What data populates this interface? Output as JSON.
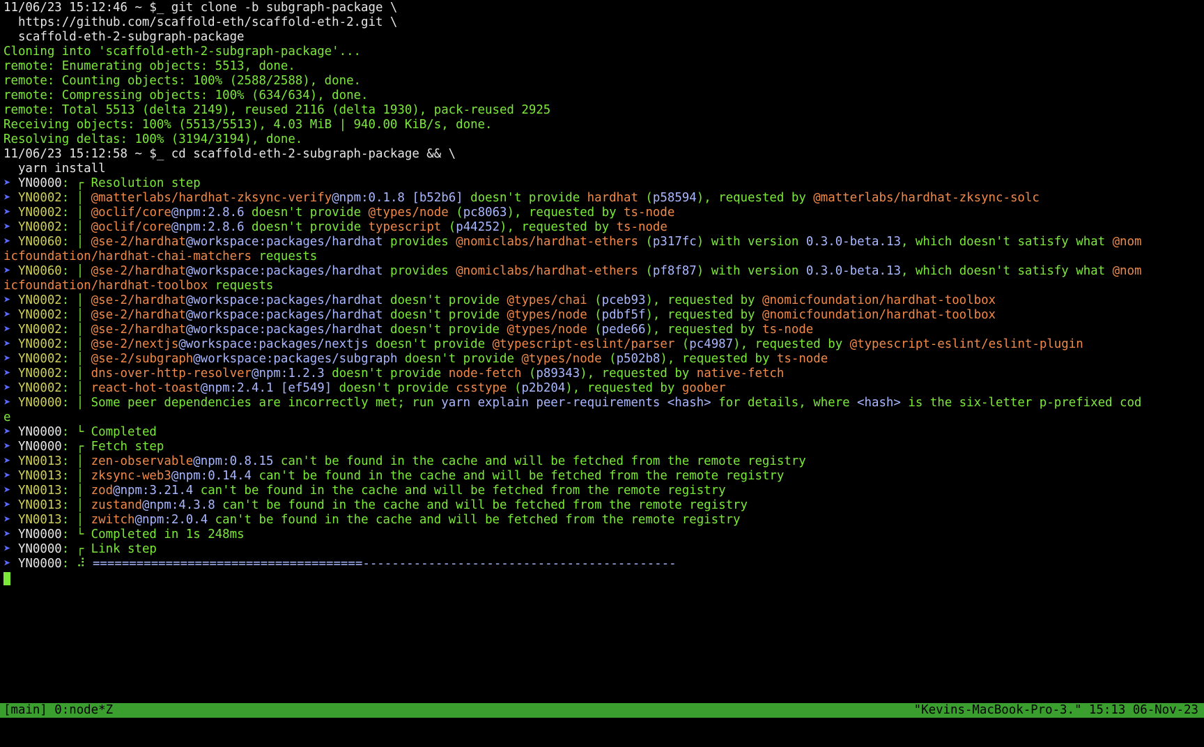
{
  "colors": {
    "green": "#7ce93a",
    "white": "#e6e6e6",
    "arrow": "#5b6bff",
    "code": "#cfd05a",
    "orange": "#f0894a",
    "blue": "#a9b7ff",
    "statusbar_bg": "#3a9f2e",
    "statusbar_fg": "#000000",
    "cursor": "#7ce93a"
  },
  "lines": [
    [
      {
        "t": "11/06/23 15:12:46 ~ $_ git clone -b subgraph-package \\",
        "c": "white"
      }
    ],
    [
      {
        "t": "  https://github.com/scaffold-eth/scaffold-eth-2.git \\",
        "c": "white"
      }
    ],
    [
      {
        "t": "  scaffold-eth-2-subgraph-package",
        "c": "white"
      }
    ],
    [
      {
        "t": "Cloning into 'scaffold-eth-2-subgraph-package'...",
        "c": "green"
      }
    ],
    [
      {
        "t": "remote: Enumerating objects: 5513, done.",
        "c": "green"
      }
    ],
    [
      {
        "t": "remote: Counting objects: 100% (2588/2588), done.",
        "c": "green"
      }
    ],
    [
      {
        "t": "remote: Compressing objects: 100% (634/634), done.",
        "c": "green"
      }
    ],
    [
      {
        "t": "remote: Total 5513 (delta 2149), reused 2116 (delta 1930), pack-reused 2925",
        "c": "green"
      }
    ],
    [
      {
        "t": "Receiving objects: 100% (5513/5513), 4.03 MiB | 940.00 KiB/s, done.",
        "c": "green"
      }
    ],
    [
      {
        "t": "Resolving deltas: 100% (3194/3194), done.",
        "c": "green"
      }
    ],
    [
      {
        "t": "11/06/23 15:12:58 ~ $_ cd scaffold-eth-2-subgraph-package && \\",
        "c": "white"
      }
    ],
    [
      {
        "t": "  yarn install",
        "c": "white"
      }
    ],
    [
      {
        "t": "➤ ",
        "c": "arrow"
      },
      {
        "t": "YN0000",
        "c": "white"
      },
      {
        "t": ": ",
        "c": "green"
      },
      {
        "t": "┌ Resolution step",
        "c": "green"
      }
    ],
    [
      {
        "t": "➤ ",
        "c": "arrow"
      },
      {
        "t": "YN0002",
        "c": "code"
      },
      {
        "t": ": │ ",
        "c": "green"
      },
      {
        "t": "@matterlabs/",
        "c": "orange"
      },
      {
        "t": "hardhat-zksync-verify",
        "c": "orange"
      },
      {
        "t": "@npm:0.1.8 [b52b6]",
        "c": "blue"
      },
      {
        "t": " doesn't provide ",
        "c": "green"
      },
      {
        "t": "hardhat",
        "c": "orange"
      },
      {
        "t": " (",
        "c": "green"
      },
      {
        "t": "p58594",
        "c": "blue"
      },
      {
        "t": "), requested by ",
        "c": "green"
      },
      {
        "t": "@matterlabs/hardhat-zksync-solc",
        "c": "orange"
      }
    ],
    [
      {
        "t": "➤ ",
        "c": "arrow"
      },
      {
        "t": "YN0002",
        "c": "code"
      },
      {
        "t": ": │ ",
        "c": "green"
      },
      {
        "t": "@oclif/",
        "c": "orange"
      },
      {
        "t": "core",
        "c": "orange"
      },
      {
        "t": "@npm:2.8.6",
        "c": "blue"
      },
      {
        "t": " doesn't provide ",
        "c": "green"
      },
      {
        "t": "@types/node",
        "c": "orange"
      },
      {
        "t": " (",
        "c": "green"
      },
      {
        "t": "pc8063",
        "c": "blue"
      },
      {
        "t": "), requested by ",
        "c": "green"
      },
      {
        "t": "ts-node",
        "c": "orange"
      }
    ],
    [
      {
        "t": "➤ ",
        "c": "arrow"
      },
      {
        "t": "YN0002",
        "c": "code"
      },
      {
        "t": ": │ ",
        "c": "green"
      },
      {
        "t": "@oclif/",
        "c": "orange"
      },
      {
        "t": "core",
        "c": "orange"
      },
      {
        "t": "@npm:2.8.6",
        "c": "blue"
      },
      {
        "t": " doesn't provide ",
        "c": "green"
      },
      {
        "t": "typescript",
        "c": "orange"
      },
      {
        "t": " (",
        "c": "green"
      },
      {
        "t": "p44252",
        "c": "blue"
      },
      {
        "t": "), requested by ",
        "c": "green"
      },
      {
        "t": "ts-node",
        "c": "orange"
      }
    ],
    [
      {
        "t": "➤ ",
        "c": "arrow"
      },
      {
        "t": "YN0060",
        "c": "code"
      },
      {
        "t": ": │ ",
        "c": "green"
      },
      {
        "t": "@se-2/",
        "c": "orange"
      },
      {
        "t": "hardhat",
        "c": "orange"
      },
      {
        "t": "@workspace:packages/hardhat",
        "c": "blue"
      },
      {
        "t": " provides ",
        "c": "green"
      },
      {
        "t": "@nomiclabs/hardhat-ethers",
        "c": "orange"
      },
      {
        "t": " (",
        "c": "green"
      },
      {
        "t": "p317fc",
        "c": "blue"
      },
      {
        "t": ") with version ",
        "c": "green"
      },
      {
        "t": "0.3.0-beta.13",
        "c": "blue"
      },
      {
        "t": ", which doesn't satisfy what ",
        "c": "green"
      },
      {
        "t": "@nom",
        "c": "orange"
      }
    ],
    [
      {
        "t": "icfoundation/hardhat-chai-matchers",
        "c": "orange"
      },
      {
        "t": " requests",
        "c": "green"
      }
    ],
    [
      {
        "t": "➤ ",
        "c": "arrow"
      },
      {
        "t": "YN0060",
        "c": "code"
      },
      {
        "t": ": │ ",
        "c": "green"
      },
      {
        "t": "@se-2/",
        "c": "orange"
      },
      {
        "t": "hardhat",
        "c": "orange"
      },
      {
        "t": "@workspace:packages/hardhat",
        "c": "blue"
      },
      {
        "t": " provides ",
        "c": "green"
      },
      {
        "t": "@nomiclabs/hardhat-ethers",
        "c": "orange"
      },
      {
        "t": " (",
        "c": "green"
      },
      {
        "t": "pf8f87",
        "c": "blue"
      },
      {
        "t": ") with version ",
        "c": "green"
      },
      {
        "t": "0.3.0-beta.13",
        "c": "blue"
      },
      {
        "t": ", which doesn't satisfy what ",
        "c": "green"
      },
      {
        "t": "@nom",
        "c": "orange"
      }
    ],
    [
      {
        "t": "icfoundation/hardhat-toolbox",
        "c": "orange"
      },
      {
        "t": " requests",
        "c": "green"
      }
    ],
    [
      {
        "t": "➤ ",
        "c": "arrow"
      },
      {
        "t": "YN0002",
        "c": "code"
      },
      {
        "t": ": │ ",
        "c": "green"
      },
      {
        "t": "@se-2/",
        "c": "orange"
      },
      {
        "t": "hardhat",
        "c": "orange"
      },
      {
        "t": "@workspace:packages/hardhat",
        "c": "blue"
      },
      {
        "t": " doesn't provide ",
        "c": "green"
      },
      {
        "t": "@types/chai",
        "c": "orange"
      },
      {
        "t": " (",
        "c": "green"
      },
      {
        "t": "pceb93",
        "c": "blue"
      },
      {
        "t": "), requested by ",
        "c": "green"
      },
      {
        "t": "@nomicfoundation/hardhat-toolbox",
        "c": "orange"
      }
    ],
    [
      {
        "t": "➤ ",
        "c": "arrow"
      },
      {
        "t": "YN0002",
        "c": "code"
      },
      {
        "t": ": │ ",
        "c": "green"
      },
      {
        "t": "@se-2/",
        "c": "orange"
      },
      {
        "t": "hardhat",
        "c": "orange"
      },
      {
        "t": "@workspace:packages/hardhat",
        "c": "blue"
      },
      {
        "t": " doesn't provide ",
        "c": "green"
      },
      {
        "t": "@types/node",
        "c": "orange"
      },
      {
        "t": " (",
        "c": "green"
      },
      {
        "t": "pdbf5f",
        "c": "blue"
      },
      {
        "t": "), requested by ",
        "c": "green"
      },
      {
        "t": "@nomicfoundation/hardhat-toolbox",
        "c": "orange"
      }
    ],
    [
      {
        "t": "➤ ",
        "c": "arrow"
      },
      {
        "t": "YN0002",
        "c": "code"
      },
      {
        "t": ": │ ",
        "c": "green"
      },
      {
        "t": "@se-2/",
        "c": "orange"
      },
      {
        "t": "hardhat",
        "c": "orange"
      },
      {
        "t": "@workspace:packages/hardhat",
        "c": "blue"
      },
      {
        "t": " doesn't provide ",
        "c": "green"
      },
      {
        "t": "@types/node",
        "c": "orange"
      },
      {
        "t": " (",
        "c": "green"
      },
      {
        "t": "pede66",
        "c": "blue"
      },
      {
        "t": "), requested by ",
        "c": "green"
      },
      {
        "t": "ts-node",
        "c": "orange"
      }
    ],
    [
      {
        "t": "➤ ",
        "c": "arrow"
      },
      {
        "t": "YN0002",
        "c": "code"
      },
      {
        "t": ": │ ",
        "c": "green"
      },
      {
        "t": "@se-2/",
        "c": "orange"
      },
      {
        "t": "nextjs",
        "c": "orange"
      },
      {
        "t": "@workspace:packages/nextjs",
        "c": "blue"
      },
      {
        "t": " doesn't provide ",
        "c": "green"
      },
      {
        "t": "@typescript-eslint/parser",
        "c": "orange"
      },
      {
        "t": " (",
        "c": "green"
      },
      {
        "t": "pc4987",
        "c": "blue"
      },
      {
        "t": "), requested by ",
        "c": "green"
      },
      {
        "t": "@typescript-eslint/eslint-plugin",
        "c": "orange"
      }
    ],
    [
      {
        "t": "➤ ",
        "c": "arrow"
      },
      {
        "t": "YN0002",
        "c": "code"
      },
      {
        "t": ": │ ",
        "c": "green"
      },
      {
        "t": "@se-2/",
        "c": "orange"
      },
      {
        "t": "subgraph",
        "c": "orange"
      },
      {
        "t": "@workspace:packages/subgraph",
        "c": "blue"
      },
      {
        "t": " doesn't provide ",
        "c": "green"
      },
      {
        "t": "@types/node",
        "c": "orange"
      },
      {
        "t": " (",
        "c": "green"
      },
      {
        "t": "p502b8",
        "c": "blue"
      },
      {
        "t": "), requested by ",
        "c": "green"
      },
      {
        "t": "ts-node",
        "c": "orange"
      }
    ],
    [
      {
        "t": "➤ ",
        "c": "arrow"
      },
      {
        "t": "YN0002",
        "c": "code"
      },
      {
        "t": ": │ ",
        "c": "green"
      },
      {
        "t": "dns-over-http-resolver",
        "c": "orange"
      },
      {
        "t": "@npm:1.2.3",
        "c": "blue"
      },
      {
        "t": " doesn't provide ",
        "c": "green"
      },
      {
        "t": "node-fetch",
        "c": "orange"
      },
      {
        "t": " (",
        "c": "green"
      },
      {
        "t": "p89343",
        "c": "blue"
      },
      {
        "t": "), requested by ",
        "c": "green"
      },
      {
        "t": "native-fetch",
        "c": "orange"
      }
    ],
    [
      {
        "t": "➤ ",
        "c": "arrow"
      },
      {
        "t": "YN0002",
        "c": "code"
      },
      {
        "t": ": │ ",
        "c": "green"
      },
      {
        "t": "react-hot-toast",
        "c": "orange"
      },
      {
        "t": "@npm:2.4.1 [ef549]",
        "c": "blue"
      },
      {
        "t": " doesn't provide ",
        "c": "green"
      },
      {
        "t": "csstype",
        "c": "orange"
      },
      {
        "t": " (",
        "c": "green"
      },
      {
        "t": "p2b204",
        "c": "blue"
      },
      {
        "t": "), requested by ",
        "c": "green"
      },
      {
        "t": "goober",
        "c": "orange"
      }
    ],
    [
      {
        "t": "➤ ",
        "c": "arrow"
      },
      {
        "t": "YN0000",
        "c": "code"
      },
      {
        "t": ": │ ",
        "c": "green"
      },
      {
        "t": "Some peer dependencies are incorrectly met; run ",
        "c": "green"
      },
      {
        "t": "yarn explain peer-requirements <hash>",
        "c": "blue"
      },
      {
        "t": " for details, where ",
        "c": "green"
      },
      {
        "t": "<hash>",
        "c": "blue"
      },
      {
        "t": " is the six-letter p-prefixed cod",
        "c": "green"
      }
    ],
    [
      {
        "t": "e",
        "c": "green"
      }
    ],
    [
      {
        "t": "➤ ",
        "c": "arrow"
      },
      {
        "t": "YN0000",
        "c": "white"
      },
      {
        "t": ": ",
        "c": "green"
      },
      {
        "t": "└ Completed",
        "c": "green"
      }
    ],
    [
      {
        "t": "➤ ",
        "c": "arrow"
      },
      {
        "t": "YN0000",
        "c": "white"
      },
      {
        "t": ": ",
        "c": "green"
      },
      {
        "t": "┌ Fetch step",
        "c": "green"
      }
    ],
    [
      {
        "t": "➤ ",
        "c": "arrow"
      },
      {
        "t": "YN0013",
        "c": "code"
      },
      {
        "t": ": │ ",
        "c": "green"
      },
      {
        "t": "zen-observable",
        "c": "orange"
      },
      {
        "t": "@npm:0.8.15",
        "c": "blue"
      },
      {
        "t": " can't be found in the cache and will be fetched from the remote registry",
        "c": "green"
      }
    ],
    [
      {
        "t": "➤ ",
        "c": "arrow"
      },
      {
        "t": "YN0013",
        "c": "code"
      },
      {
        "t": ": │ ",
        "c": "green"
      },
      {
        "t": "zksync-web3",
        "c": "orange"
      },
      {
        "t": "@npm:0.14.4",
        "c": "blue"
      },
      {
        "t": " can't be found in the cache and will be fetched from the remote registry",
        "c": "green"
      }
    ],
    [
      {
        "t": "➤ ",
        "c": "arrow"
      },
      {
        "t": "YN0013",
        "c": "code"
      },
      {
        "t": ": │ ",
        "c": "green"
      },
      {
        "t": "zod",
        "c": "orange"
      },
      {
        "t": "@npm:3.21.4",
        "c": "blue"
      },
      {
        "t": " can't be found in the cache and will be fetched from the remote registry",
        "c": "green"
      }
    ],
    [
      {
        "t": "➤ ",
        "c": "arrow"
      },
      {
        "t": "YN0013",
        "c": "code"
      },
      {
        "t": ": │ ",
        "c": "green"
      },
      {
        "t": "zustand",
        "c": "orange"
      },
      {
        "t": "@npm:4.3.8",
        "c": "blue"
      },
      {
        "t": " can't be found in the cache and will be fetched from the remote registry",
        "c": "green"
      }
    ],
    [
      {
        "t": "➤ ",
        "c": "arrow"
      },
      {
        "t": "YN0013",
        "c": "code"
      },
      {
        "t": ": │ ",
        "c": "green"
      },
      {
        "t": "zwitch",
        "c": "orange"
      },
      {
        "t": "@npm:2.0.4",
        "c": "blue"
      },
      {
        "t": " can't be found in the cache and will be fetched from the remote registry",
        "c": "green"
      }
    ],
    [
      {
        "t": "➤ ",
        "c": "arrow"
      },
      {
        "t": "YN0000",
        "c": "white"
      },
      {
        "t": ": ",
        "c": "green"
      },
      {
        "t": "└ Completed in 1s 248ms",
        "c": "green"
      }
    ],
    [
      {
        "t": "➤ ",
        "c": "arrow"
      },
      {
        "t": "YN0000",
        "c": "white"
      },
      {
        "t": ": ",
        "c": "green"
      },
      {
        "t": "┌ Link step",
        "c": "green"
      }
    ],
    [
      {
        "t": "➤ ",
        "c": "arrow"
      },
      {
        "t": "YN0000",
        "c": "white"
      },
      {
        "t": ": ",
        "c": "green"
      },
      {
        "t": "⠼ ",
        "c": "green"
      },
      {
        "t": "=====================================",
        "c": "blue"
      },
      {
        "t": "-------------------------------------------",
        "c": "blue"
      }
    ]
  ],
  "statusbar": {
    "left": "[main] 0:node*Z",
    "right": "\"Kevins-MacBook-Pro-3.\" 15:13 06-Nov-23"
  }
}
